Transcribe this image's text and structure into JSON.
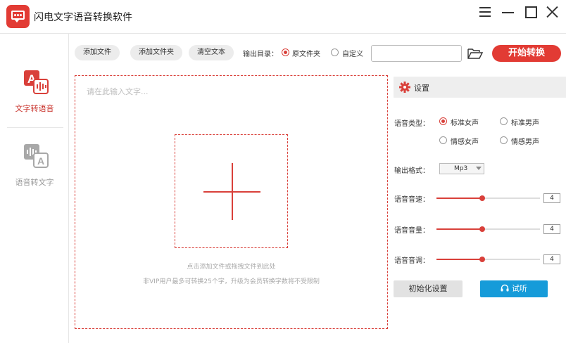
{
  "app": {
    "title": "闪电文字语音转换软件"
  },
  "sidebar": {
    "items": [
      {
        "label": "文字转语音",
        "active": true,
        "icon": "text-to-speech-icon"
      },
      {
        "label": "语音转文字",
        "active": false,
        "icon": "speech-to-text-icon"
      }
    ]
  },
  "toolbar": {
    "add_file": "添加文件",
    "add_folder": "添加文件夹",
    "clear_text": "清空文本",
    "output_dir_label": "输出目录：",
    "output_options": [
      "原文件夹",
      "自定义"
    ],
    "output_selected": "原文件夹",
    "output_path": "",
    "start": "开始转换"
  },
  "editor": {
    "placeholder": "请在此输入文字...",
    "hint_drop": "点击添加文件或拖拽文件到此处",
    "hint_limit": "非VIP用户最多可转换25个字，升级为会员转换字数将不受限制"
  },
  "settings": {
    "title": "设置",
    "voice_type_label": "语音类型：",
    "voice_options": [
      "标准女声",
      "标准男声",
      "情感女声",
      "情感男声"
    ],
    "voice_selected": "标准女声",
    "format_label": "输出格式：",
    "format_value": "Mp3",
    "speed": {
      "label": "语音音速：",
      "value": "4",
      "fraction": 0.44
    },
    "volume": {
      "label": "语音音量：",
      "value": "4",
      "fraction": 0.44
    },
    "pitch": {
      "label": "语音音调：",
      "value": "4",
      "fraction": 0.44
    },
    "reset": "初始化设置",
    "listen": "试听"
  },
  "colors": {
    "accent": "#e23b34",
    "blue": "#169bd9"
  }
}
